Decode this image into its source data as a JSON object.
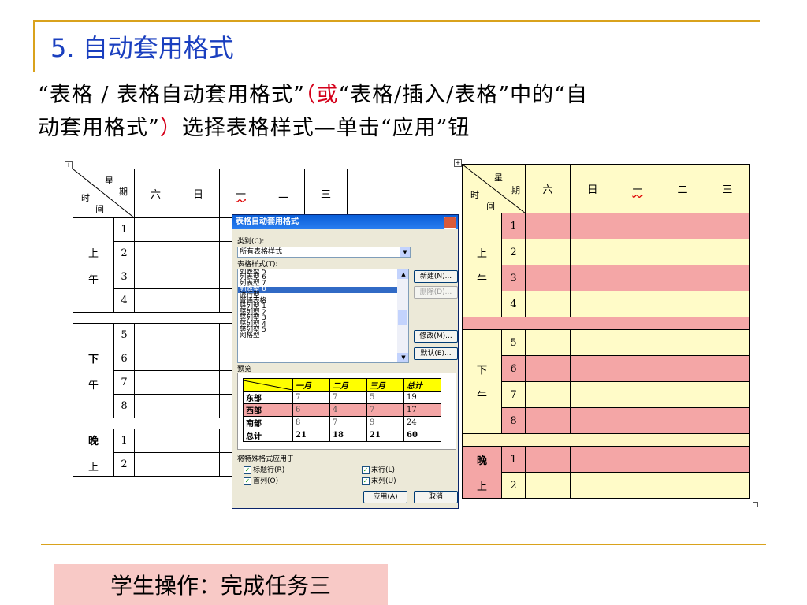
{
  "slide": {
    "title": "5.  自动套用格式",
    "line1_part1": "“表格 / 表格自动套用格式”",
    "line1_red": "（或",
    "line1_part2": "“表格/插入/表格”中的“自",
    "line2_part1": "动套用格式”",
    "line2_red": "）",
    "line2_part2": "选择表格样式—单击“应用”钮",
    "task_label": "学生操作：完成任务三"
  },
  "schedule": {
    "corner_xing": "星",
    "corner_qi": "期",
    "corner_shi": "时",
    "corner_jian": "间",
    "days": [
      "六",
      "日",
      "一",
      "二",
      "三"
    ],
    "morning": [
      "上",
      "午"
    ],
    "afternoon": [
      "下",
      "午"
    ],
    "evening": [
      "晚",
      "上"
    ],
    "morning_periods": [
      "1",
      "2",
      "3",
      "4"
    ],
    "afternoon_periods": [
      "5",
      "6",
      "7",
      "8"
    ],
    "evening_periods": [
      "1",
      "2"
    ]
  },
  "dialog": {
    "title": "表格自动套用格式",
    "category_label": "类别(C):",
    "category_value": "所有表格样式",
    "style_label": "表格样式(T):",
    "styles": [
      "列表型 5",
      "列表型 6",
      "列表型 7",
      "列表型 8",
      "流行型",
      "普通表格",
      "竖列型 1",
      "竖列型 2",
      "竖列型 3",
      "竖列型 4",
      "竖列型 5",
      "网格型"
    ],
    "selected_style": "列表型 8",
    "new_button": "新建(N)...",
    "delete_button": "删除(D)...",
    "modify_button": "修改(M)...",
    "default_button": "默认(E)...",
    "preview_label": "预览",
    "preview_headers": [
      "一月",
      "二月",
      "三月",
      "总计"
    ],
    "preview_rows": [
      {
        "name": "东部",
        "values": [
          "7",
          "7",
          "5",
          "19"
        ]
      },
      {
        "name": "西部",
        "values": [
          "6",
          "4",
          "7",
          "17"
        ]
      },
      {
        "name": "南部",
        "values": [
          "8",
          "7",
          "9",
          "24"
        ]
      },
      {
        "name": "总计",
        "values": [
          "21",
          "18",
          "21",
          "60"
        ]
      }
    ],
    "apply_special_label": "将特殊格式应用于",
    "chk_header_row": "标题行(R)",
    "chk_first_col": "首列(O)",
    "chk_last_row": "末行(L)",
    "chk_last_col": "末列(U)",
    "apply_button": "应用(A)",
    "cancel_button": "取消"
  },
  "colors": {
    "accent_gold": "#d9a21c",
    "title_blue": "#1a3fbf",
    "red_text": "#d4001a",
    "task_bg": "#f8c9c6",
    "row_pink": "#f4a6a6",
    "row_yellow": "#fffbc8",
    "preview_header_yellow": "#ffff00"
  }
}
